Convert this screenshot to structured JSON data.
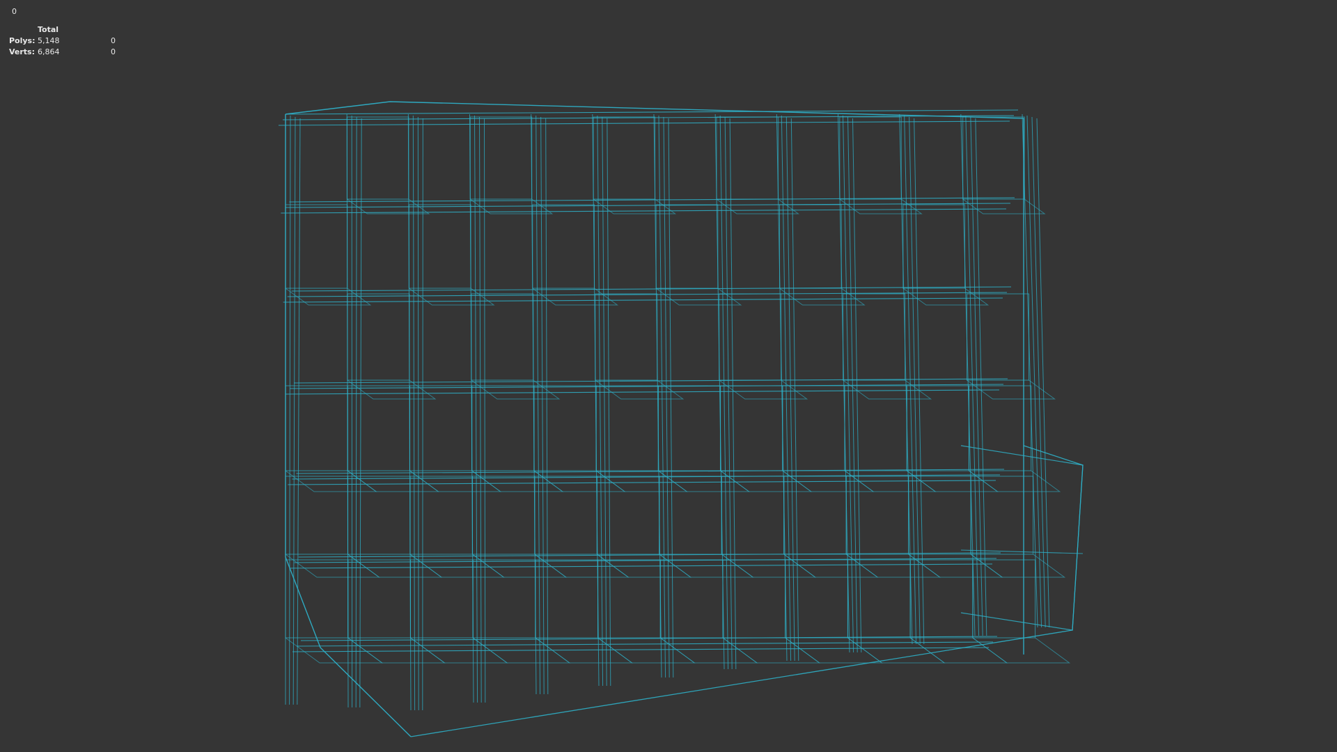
{
  "viewport": {
    "frame_number": "0",
    "wire_color": "#2eb0c8",
    "background": "#353535",
    "stats": {
      "header": "Total",
      "rows": [
        {
          "label": "Polys:",
          "total": "5,148",
          "selected": "0"
        },
        {
          "label": "Verts:",
          "total": "6,864",
          "selected": "0"
        }
      ]
    }
  }
}
